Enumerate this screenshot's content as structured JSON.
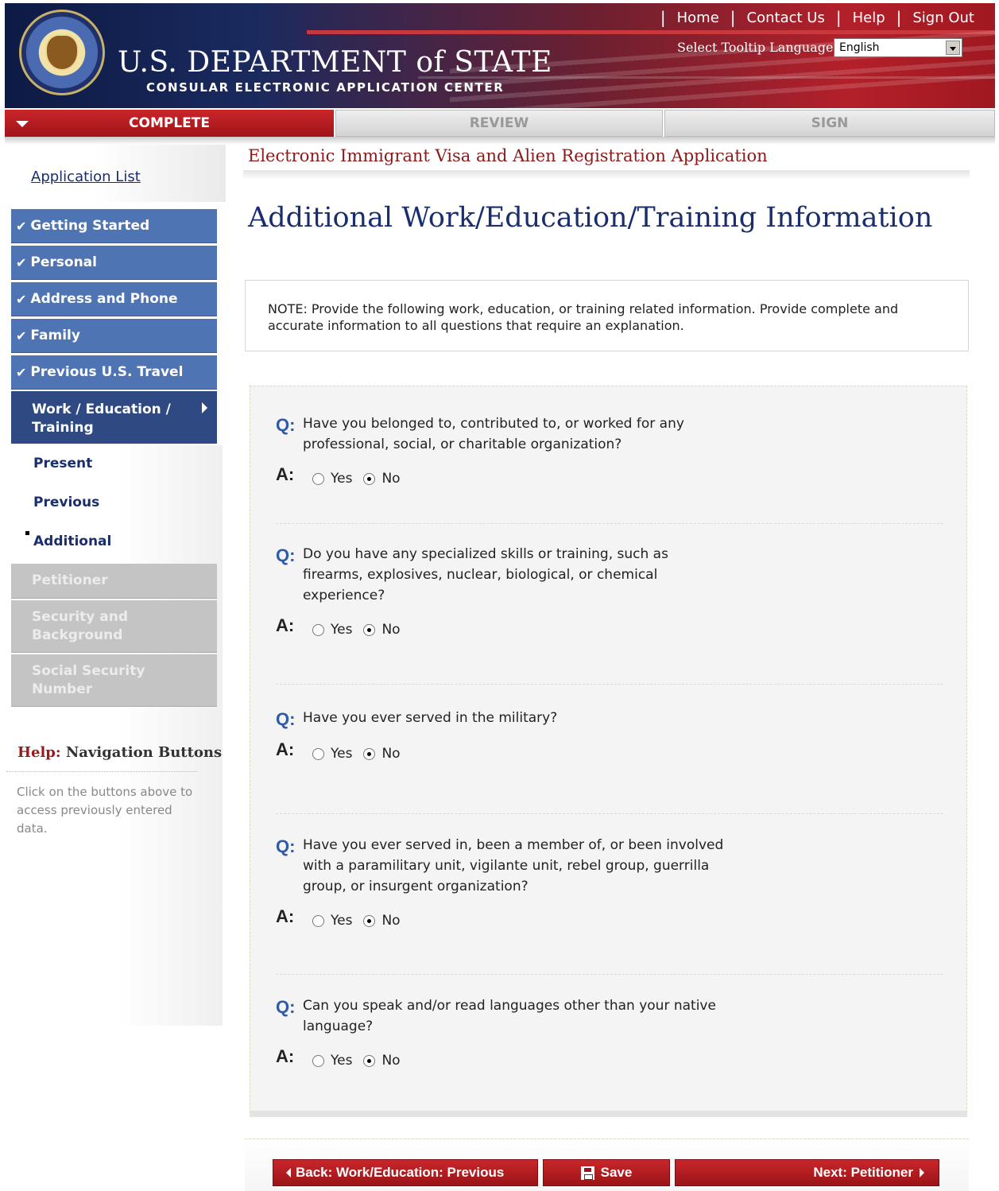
{
  "header": {
    "top_links": [
      "Home",
      "Contact Us",
      "Help",
      "Sign Out"
    ],
    "title": "U.S. DEPARTMENT of STATE",
    "subtitle": "CONSULAR ELECTRONIC APPLICATION CENTER",
    "tooltip_label": "Select Tooltip Language:",
    "tooltip_value": "English"
  },
  "steps": [
    "COMPLETE",
    "REVIEW",
    "SIGN"
  ],
  "sidebar": {
    "app_list": "Application List",
    "done_items": [
      "Getting Started",
      "Personal",
      "Address and Phone",
      "Family",
      "Previous U.S. Travel"
    ],
    "current_item": "Work / Education / Training",
    "sub_items": [
      "Present",
      "Previous",
      "Additional"
    ],
    "disabled_items": [
      "Petitioner",
      "Security and Background",
      "Social Security Number"
    ],
    "help_label": "Help:",
    "help_title": "Navigation Buttons",
    "help_text": "Click on the buttons above to access previously entered data."
  },
  "main": {
    "form_title": "Electronic Immigrant Visa and Alien Registration Application",
    "page_title": "Additional Work/Education/Training Information",
    "note": "NOTE: Provide the following work, education, or training related information. Provide complete and accurate information to all questions that require an explanation.",
    "q_label": "Q:",
    "a_label": "A:",
    "yes_label": "Yes",
    "no_label": "No",
    "questions": [
      {
        "text": "Have you belonged to, contributed to, or worked for any professional, social, or charitable organization?",
        "answer": "No"
      },
      {
        "text": "Do you have any specialized skills or training, such as firearms, explosives, nuclear, biological, or chemical experience?",
        "answer": "No"
      },
      {
        "text": "Have you ever served in the military?",
        "answer": "No"
      },
      {
        "text": "Have you ever served in, been a member of, or been involved with a paramilitary unit, vigilante unit, rebel group, guerrilla group, or insurgent organization?",
        "answer": "No"
      },
      {
        "text": "Can you speak and/or read languages other than your native language?",
        "answer": "No"
      }
    ]
  },
  "buttons": {
    "back": "Back: Work/Education: Previous",
    "save": "Save",
    "next": "Next: Petitioner"
  }
}
